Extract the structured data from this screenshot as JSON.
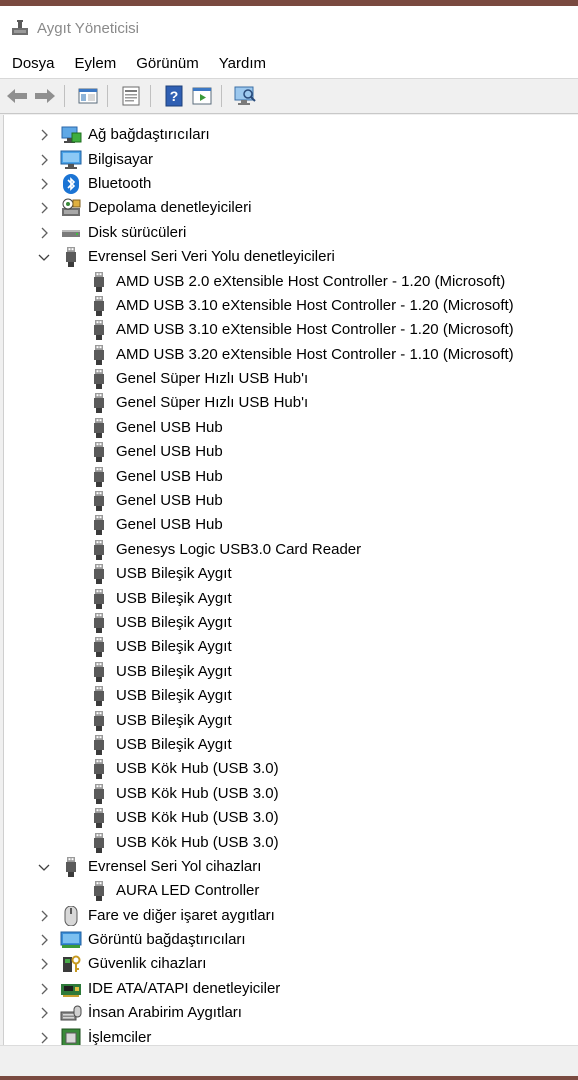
{
  "window": {
    "title": "Aygıt Yöneticisi"
  },
  "menu": [
    "Dosya",
    "Eylem",
    "Görünüm",
    "Yardım"
  ],
  "toolbar": [
    {
      "name": "back-arrow-icon"
    },
    {
      "name": "forward-arrow-icon"
    },
    {
      "name": "show-hide-console-tree-icon"
    },
    {
      "name": "properties-icon"
    },
    {
      "name": "help-icon"
    },
    {
      "name": "run-icon"
    },
    {
      "name": "scan-hardware-icon"
    }
  ],
  "tree": [
    {
      "label": "Ağ bağdaştırıcıları",
      "icon": "network-adapter-icon",
      "expanded": false
    },
    {
      "label": "Bilgisayar",
      "icon": "computer-icon",
      "expanded": false
    },
    {
      "label": "Bluetooth",
      "icon": "bluetooth-icon",
      "expanded": false
    },
    {
      "label": "Depolama denetleyicileri",
      "icon": "storage-controller-icon",
      "expanded": false
    },
    {
      "label": "Disk sürücüleri",
      "icon": "disk-drive-icon",
      "expanded": false
    },
    {
      "label": "Evrensel Seri Veri Yolu denetleyicileri",
      "icon": "usb-connector-icon",
      "expanded": true,
      "children": [
        "AMD USB 2.0 eXtensible Host Controller - 1.20 (Microsoft)",
        "AMD USB 3.10 eXtensible Host Controller - 1.20 (Microsoft)",
        "AMD USB 3.10 eXtensible Host Controller - 1.20 (Microsoft)",
        "AMD USB 3.20 eXtensible Host Controller - 1.10 (Microsoft)",
        "Genel Süper Hızlı USB Hub'ı",
        "Genel Süper Hızlı USB Hub'ı",
        "Genel USB Hub",
        "Genel USB Hub",
        "Genel USB Hub",
        "Genel USB Hub",
        "Genel USB Hub",
        "Genesys Logic USB3.0 Card Reader",
        "USB Bileşik Aygıt",
        "USB Bileşik Aygıt",
        "USB Bileşik Aygıt",
        "USB Bileşik Aygıt",
        "USB Bileşik Aygıt",
        "USB Bileşik Aygıt",
        "USB Bileşik Aygıt",
        "USB Bileşik Aygıt",
        "USB Kök Hub (USB 3.0)",
        "USB Kök Hub (USB 3.0)",
        "USB Kök Hub (USB 3.0)",
        "USB Kök Hub (USB 3.0)"
      ]
    },
    {
      "label": "Evrensel Seri Yol cihazları",
      "icon": "usb-connector-icon",
      "expanded": true,
      "children": [
        "AURA LED Controller"
      ]
    },
    {
      "label": "Fare ve diğer işaret aygıtları",
      "icon": "mouse-icon",
      "expanded": false
    },
    {
      "label": "Görüntü bağdaştırıcıları",
      "icon": "display-adapter-icon",
      "expanded": false
    },
    {
      "label": "Güvenlik cihazları",
      "icon": "security-device-icon",
      "expanded": false
    },
    {
      "label": "IDE ATA/ATAPI denetleyiciler",
      "icon": "ide-controller-icon",
      "expanded": false
    },
    {
      "label": "İnsan Arabirim Aygıtları",
      "icon": "human-interface-device-icon",
      "expanded": false
    },
    {
      "label": "İşlemciler",
      "icon": "processor-icon",
      "expanded": false
    }
  ],
  "colors": {
    "accent": "#7a4a40",
    "tree_background": "#ffffff",
    "chrome": "#f0f0f0"
  }
}
